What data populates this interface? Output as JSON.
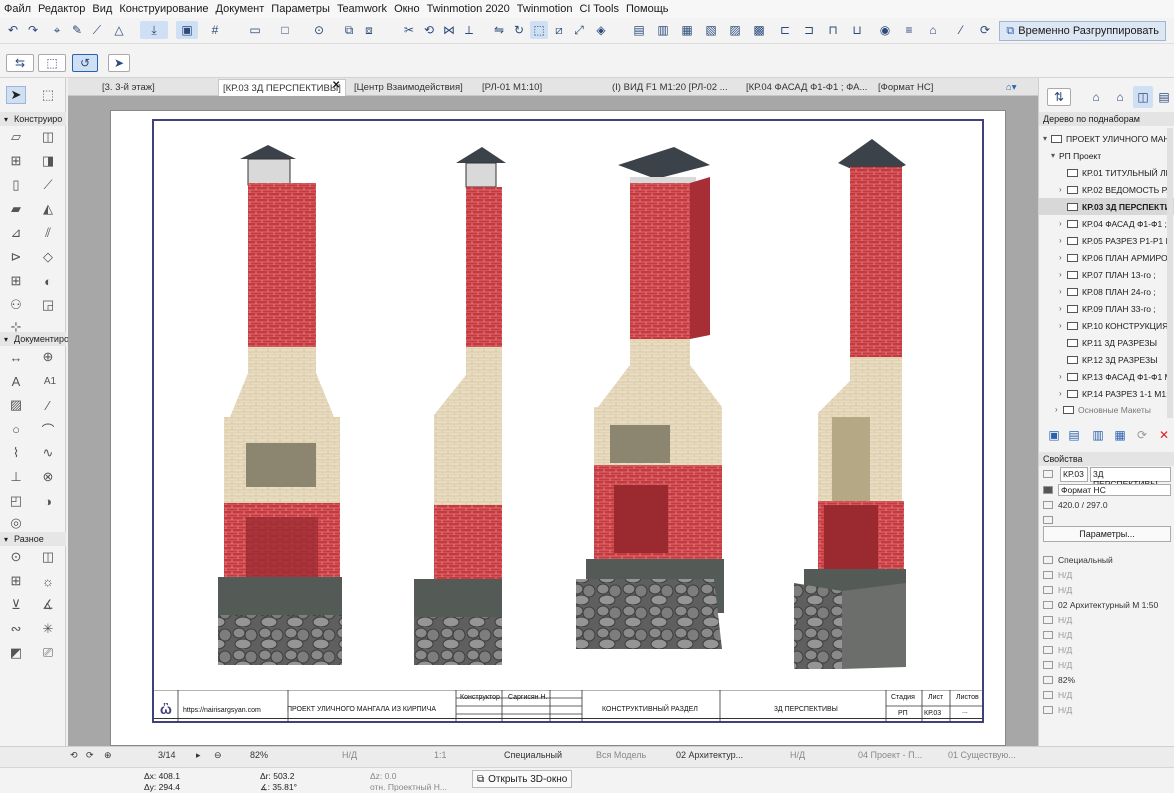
{
  "menu": [
    "Файл",
    "Редактор",
    "Вид",
    "Конструирование",
    "Документ",
    "Параметры",
    "Teamwork",
    "Окно",
    "Twinmotion 2020",
    "Twinmotion",
    "CI Tools",
    "Помощь"
  ],
  "toolbar": {
    "regroup_label": "Временно Разгруппировать"
  },
  "tabs": [
    {
      "label": "[3. 3-й этаж]"
    },
    {
      "label": "[КР.03 3Д ПЕРСПЕКТИВЫ]"
    },
    {
      "label": "[Центр Взаимодействия]"
    },
    {
      "label": "[РЛ-01 М1:10]"
    },
    {
      "label": "(I) ВИД F1 М1:20 [РЛ-02 ..."
    },
    {
      "label": "[КР.04 ФАСАД Ф1-Ф1 ; ФА..."
    },
    {
      "label": "[Формат НС]"
    }
  ],
  "left_panel": {
    "section_construct": "Конструиро",
    "section_document": "Документиро",
    "section_misc": "Разное",
    "label_tool": "A1"
  },
  "title_block": {
    "site": "https://nairisargsyan.com",
    "project": "ПРОЕКТ УЛИЧНОГО МАНГАЛА ИЗ КИРПИЧА",
    "constructor_label": "Конструктор",
    "constructor_name": "Саргисян Н.",
    "section": "КОНСТРУКТИВНЫЙ РАЗДЕЛ",
    "sheet_title": "3Д ПЕРСПЕКТИВЫ",
    "stage_label": "Стадия",
    "sheet_label": "Лист",
    "sheets_label": "Листов",
    "stage_value": "РП",
    "sheet_value": "КР.03",
    "sheets_value": "..."
  },
  "navigator": {
    "header": "Дерево по поднаборам",
    "project": "ПРОЕКТ УЛИЧНОГО МАН",
    "subset": "РП Проект",
    "items": [
      {
        "label": "КР.01 ТИТУЛЬНЫЙ ЛИ",
        "expand": false,
        "selected": false
      },
      {
        "label": "КР.02 ВЕДОМОСТЬ РА",
        "expand": true,
        "selected": false
      },
      {
        "label": "КР.03 3Д ПЕРСПЕКТИ",
        "expand": false,
        "selected": true
      },
      {
        "label": "КР.04 ФАСАД Ф1-Ф1 ;",
        "expand": true,
        "selected": false
      },
      {
        "label": "КР.05 РАЗРЕЗ Р1-Р1 М",
        "expand": true,
        "selected": false
      },
      {
        "label": "КР.06 ПЛАН АРМИРО",
        "expand": true,
        "selected": false
      },
      {
        "label": "КР.07  ПЛАН 13-го ;",
        "expand": true,
        "selected": false
      },
      {
        "label": "КР.08  ПЛАН 24-го ;",
        "expand": true,
        "selected": false
      },
      {
        "label": "КР.09  ПЛАН 33-го ;",
        "expand": true,
        "selected": false
      },
      {
        "label": "КР.10 КОНСТРУКЦИЯ",
        "expand": true,
        "selected": false
      },
      {
        "label": "КР.11 3Д РАЗРЕЗЫ",
        "expand": false,
        "selected": false
      },
      {
        "label": "КР.12 3Д РАЗРЕЗЫ",
        "expand": false,
        "selected": false
      },
      {
        "label": "КР.13 ФАСАД Ф1-Ф1 М",
        "expand": true,
        "selected": false
      },
      {
        "label": "КР.14 РАЗРЕЗ 1-1 М1:",
        "expand": true,
        "selected": false
      }
    ],
    "more_item": "Основные Макеты"
  },
  "properties": {
    "header": "Свойства",
    "id": "КР.03",
    "name": "3Д ПЕРСПЕКТИВЫ",
    "format": "Формат НС",
    "size": "420.0 / 297.0",
    "params_button": "Параметры...",
    "rows": [
      {
        "label": "Специальный",
        "dim": false
      },
      {
        "label": "Н/Д",
        "dim": true
      },
      {
        "label": "Н/Д",
        "dim": true
      },
      {
        "label": "02 Архитектурный М 1:50",
        "dim": false
      },
      {
        "label": "Н/Д",
        "dim": true
      },
      {
        "label": "Н/Д",
        "dim": true
      },
      {
        "label": "Н/Д",
        "dim": true
      },
      {
        "label": "Н/Д",
        "dim": true
      },
      {
        "label": "82%",
        "dim": false
      },
      {
        "label": "Н/Д",
        "dim": true
      },
      {
        "label": "Н/Д",
        "dim": true
      }
    ]
  },
  "statusbar": {
    "page": "3/14",
    "zoom": "82%",
    "nd": "Н/Д",
    "scale": "1:1",
    "layer": "Специальный",
    "model": "Вся Модель",
    "pen": "02 Архитектур...",
    "nd2": "Н/Д",
    "project": "04 Проект - П...",
    "existing": "01 Существую..."
  },
  "coords": {
    "dx": "Δx: 408.1",
    "dy": "Δy: 294.4",
    "dr": "Δr: 503.2",
    "da": "∡: 35.81°",
    "dz": "Δz: 0.0",
    "ref": "отн. Проектный Н...",
    "open3d": "Открыть 3D-окно"
  },
  "colors": {
    "brick": "#c8383e",
    "cream": "#e9dcc0",
    "stone": "#6f6f6f",
    "concrete": "#545a56",
    "roof": "#3b4249",
    "accent": "#2a62b0"
  }
}
